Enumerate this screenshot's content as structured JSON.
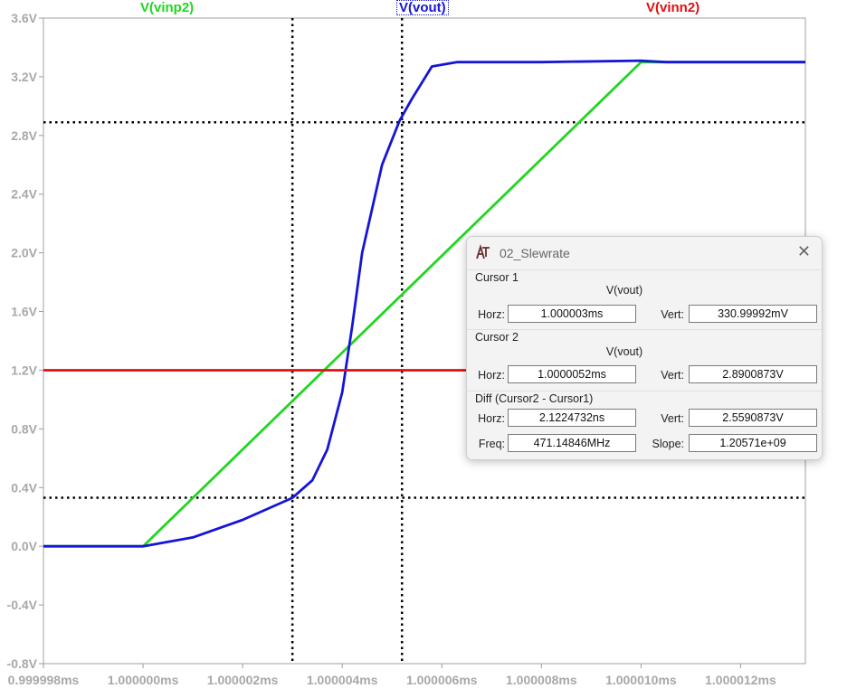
{
  "traces": {
    "vinp2": {
      "label": "V(vinp2)",
      "color": "#21d621"
    },
    "vout": {
      "label": "V(vout)",
      "color": "#1515d8"
    },
    "vinn2": {
      "label": "V(vinn2)",
      "color": "#e01010"
    }
  },
  "chart_data": {
    "type": "line",
    "y_tick_labels": [
      "3.6V",
      "3.2V",
      "2.8V",
      "2.4V",
      "2.0V",
      "1.6V",
      "1.2V",
      "0.8V",
      "0.4V",
      "0.0V",
      "-0.4V",
      "-0.8V"
    ],
    "x_tick_labels": [
      "0.999998ms",
      "1.000000ms",
      "1.000002ms",
      "1.000004ms",
      "1.000006ms",
      "1.000008ms",
      "1.000010ms",
      "1.000012ms"
    ],
    "xlim_ns_from_1ms": [
      -2.0,
      13.3
    ],
    "ylim_V": [
      -0.8,
      3.6
    ],
    "series": [
      {
        "name": "V(vinp2)",
        "color": "#21d621",
        "x_ns": [
          -2.0,
          0.0,
          10.0,
          13.3
        ],
        "y_V": [
          0.0,
          0.0,
          3.3,
          3.3
        ]
      },
      {
        "name": "V(vout)",
        "color": "#1515d8",
        "x_ns": [
          -2.0,
          0.0,
          1.0,
          2.0,
          3.0,
          3.4,
          3.7,
          4.0,
          4.2,
          4.4,
          4.8,
          5.15,
          5.4,
          5.8,
          6.3,
          8.0,
          10.0,
          10.5,
          13.3
        ],
        "y_V": [
          0.0,
          0.0,
          0.06,
          0.18,
          0.33,
          0.45,
          0.66,
          1.05,
          1.5,
          2.0,
          2.6,
          2.9,
          3.05,
          3.27,
          3.3,
          3.3,
          3.31,
          3.3,
          3.3
        ]
      },
      {
        "name": "V(vinn2)",
        "color": "#e01010",
        "x_ns": [
          -2.0,
          13.3
        ],
        "y_V": [
          1.2,
          1.2
        ]
      }
    ],
    "cursors": {
      "cursor1": {
        "x_ns": 3.0,
        "y_V": 0.331
      },
      "cursor2": {
        "x_ns": 5.2,
        "y_V": 2.89
      }
    }
  },
  "dialog": {
    "title": "02_Slewrate",
    "cursor1": {
      "section": "Cursor 1",
      "signal": "V(vout)",
      "horz_label": "Horz:",
      "horz": "1.000003ms",
      "vert_label": "Vert:",
      "vert": "330.99992mV"
    },
    "cursor2": {
      "section": "Cursor 2",
      "signal": "V(vout)",
      "horz_label": "Horz:",
      "horz": "1.0000052ms",
      "vert_label": "Vert:",
      "vert": "2.8900873V"
    },
    "diff": {
      "section": "Diff (Cursor2 - Cursor1)",
      "horz_label": "Horz:",
      "horz": "2.1224732ns",
      "vert_label": "Vert:",
      "vert": "2.5590873V",
      "freq_label": "Freq:",
      "freq": "471.14846MHz",
      "slope_label": "Slope:",
      "slope": "1.20571e+09"
    }
  }
}
